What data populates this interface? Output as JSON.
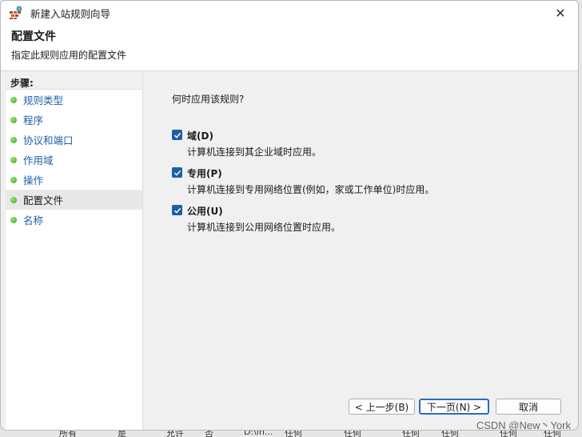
{
  "window": {
    "title": "新建入站规则向导",
    "close_glyph": "✕"
  },
  "header": {
    "title": "配置文件",
    "subtitle": "指定此规则应用的配置文件"
  },
  "sidebar": {
    "title": "步骤:",
    "items": [
      {
        "label": "规则类型"
      },
      {
        "label": "程序"
      },
      {
        "label": "协议和端口"
      },
      {
        "label": "作用域"
      },
      {
        "label": "操作"
      },
      {
        "label": "配置文件"
      },
      {
        "label": "名称"
      }
    ],
    "current_index": 5
  },
  "main": {
    "question": "何时应用该规则?",
    "options": [
      {
        "label": "域(D)",
        "desc": "计算机连接到其企业域时应用。",
        "checked": true
      },
      {
        "label": "专用(P)",
        "desc": "计算机连接到专用网络位置(例如，家或工作单位)时应用。",
        "checked": true
      },
      {
        "label": "公用(U)",
        "desc": "计算机连接到公用网络位置时应用。",
        "checked": true
      }
    ]
  },
  "buttons": {
    "back": "< 上一步(B)",
    "next": "下一页(N) >",
    "cancel": "取消"
  },
  "background_row": [
    "所有",
    "是",
    "允许",
    "否",
    "D:\\in...",
    "任何",
    "任何",
    "任何",
    "任何",
    "任何",
    "任何"
  ],
  "watermark": "CSDN @New丶York",
  "colors": {
    "accent": "#1c5fa8",
    "link": "#1f5fa8",
    "step_dot": "#3ea51e"
  }
}
